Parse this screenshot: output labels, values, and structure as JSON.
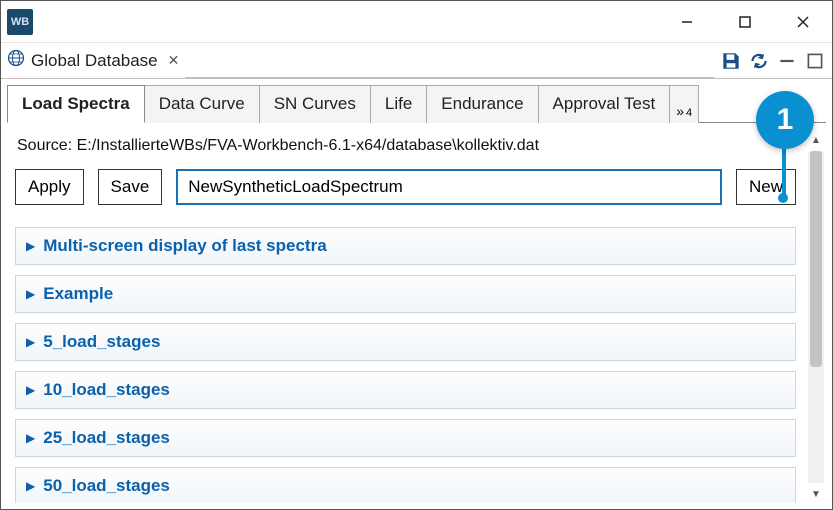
{
  "app_icon_text": "WB",
  "view": {
    "title": "Global Database"
  },
  "tabs": [
    {
      "label": "Load Spectra",
      "active": true
    },
    {
      "label": "Data Curve",
      "active": false
    },
    {
      "label": "SN Curves",
      "active": false
    },
    {
      "label": "Life",
      "active": false
    },
    {
      "label": "Endurance",
      "active": false
    },
    {
      "label": "Approval Test",
      "active": false
    }
  ],
  "tab_overflow_count": "4",
  "source_label": "Source: E:/InstallierteWBs/FVA-Workbench-6.1-x64/database\\kollektiv.dat",
  "actions": {
    "apply": "Apply",
    "save": "Save",
    "new": "New"
  },
  "name_input_value": "NewSyntheticLoadSpectrum",
  "accordion_items": [
    "Multi-screen display of last spectra",
    "Example",
    "5_load_stages",
    "10_load_stages",
    "25_load_stages",
    "50_load_stages"
  ],
  "callout_number": "1"
}
